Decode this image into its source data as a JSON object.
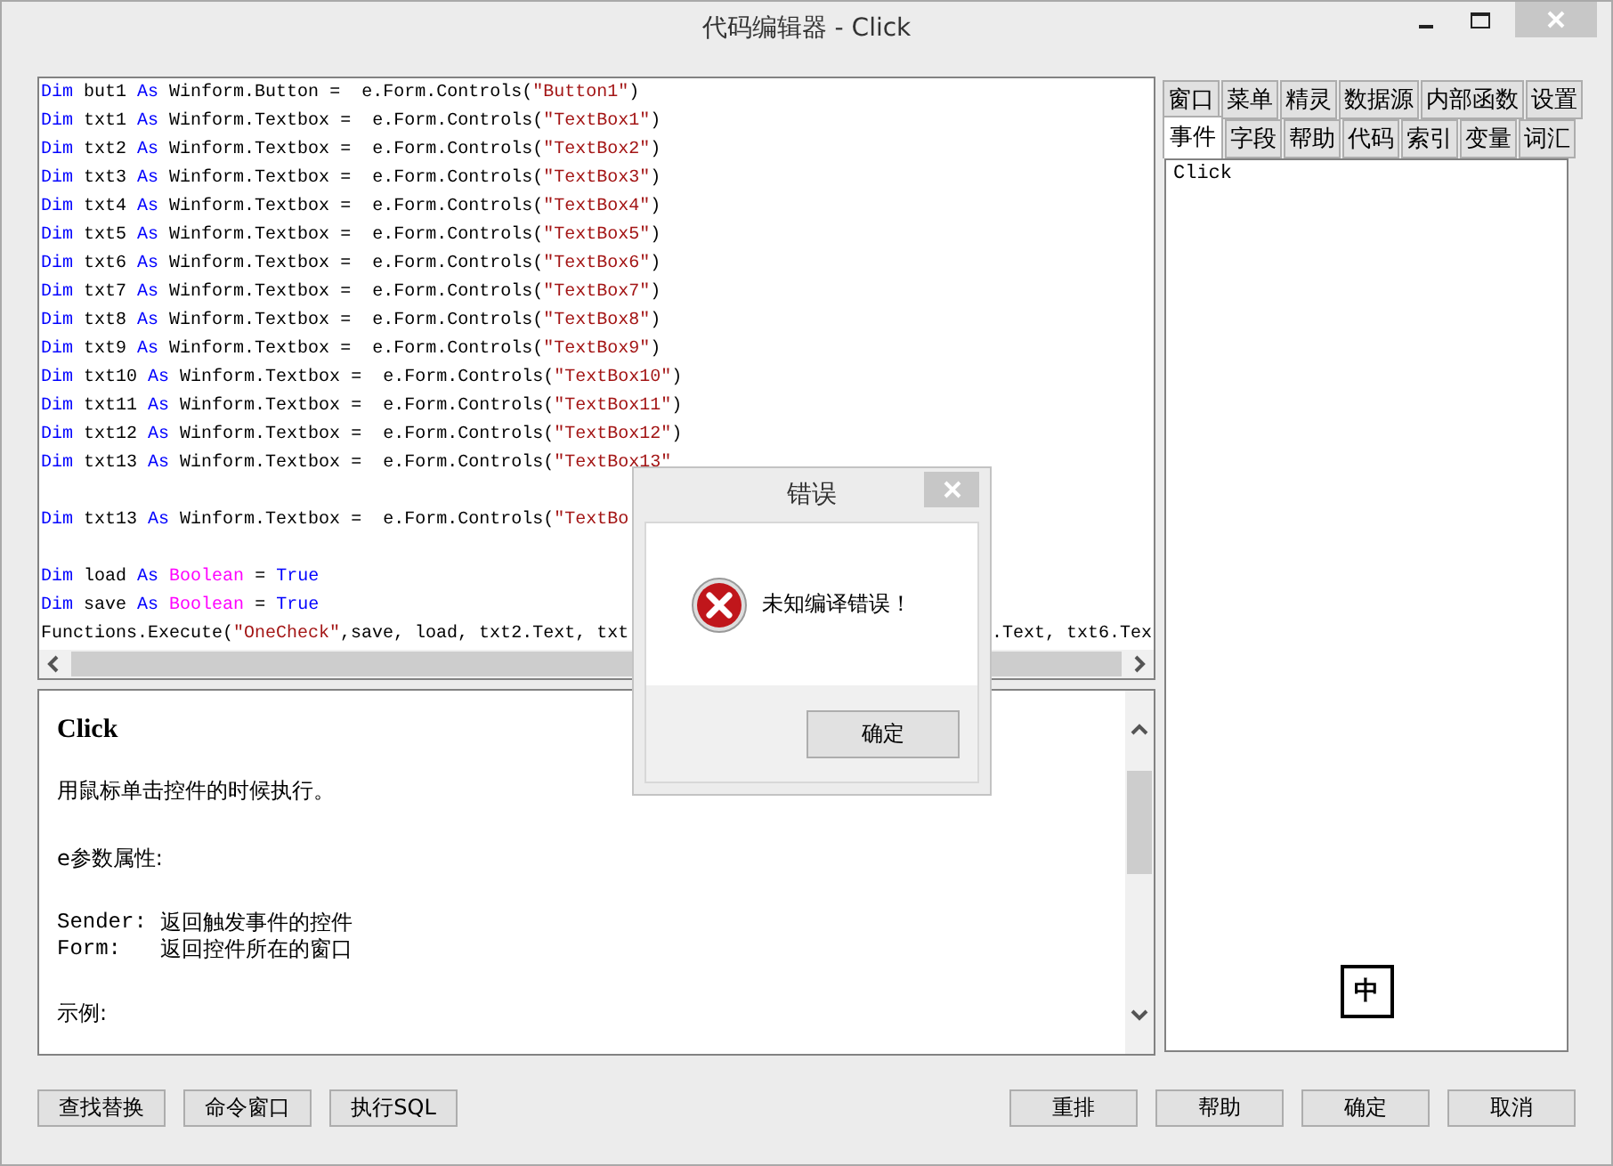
{
  "window": {
    "title": "代码编辑器 - Click"
  },
  "code_lines": [
    {
      "kind": "code",
      "segments": [
        {
          "kind": "kw",
          "text": "Dim"
        },
        {
          "kind": "plain",
          "text": " but1 "
        },
        {
          "kind": "kw",
          "text": "As"
        },
        {
          "kind": "plain",
          "text": " Winform.Button =  e.Form.Controls("
        },
        {
          "kind": "str",
          "text": "\"Button1\""
        },
        {
          "kind": "plain",
          "text": ")"
        }
      ]
    },
    {
      "kind": "code",
      "segments": [
        {
          "kind": "kw",
          "text": "Dim"
        },
        {
          "kind": "plain",
          "text": " txt1 "
        },
        {
          "kind": "kw",
          "text": "As"
        },
        {
          "kind": "plain",
          "text": " Winform.Textbox =  e.Form.Controls("
        },
        {
          "kind": "str",
          "text": "\"TextBox1\""
        },
        {
          "kind": "plain",
          "text": ")"
        }
      ]
    },
    {
      "kind": "code",
      "segments": [
        {
          "kind": "kw",
          "text": "Dim"
        },
        {
          "kind": "plain",
          "text": " txt2 "
        },
        {
          "kind": "kw",
          "text": "As"
        },
        {
          "kind": "plain",
          "text": " Winform.Textbox =  e.Form.Controls("
        },
        {
          "kind": "str",
          "text": "\"TextBox2\""
        },
        {
          "kind": "plain",
          "text": ")"
        }
      ]
    },
    {
      "kind": "code",
      "segments": [
        {
          "kind": "kw",
          "text": "Dim"
        },
        {
          "kind": "plain",
          "text": " txt3 "
        },
        {
          "kind": "kw",
          "text": "As"
        },
        {
          "kind": "plain",
          "text": " Winform.Textbox =  e.Form.Controls("
        },
        {
          "kind": "str",
          "text": "\"TextBox3\""
        },
        {
          "kind": "plain",
          "text": ")"
        }
      ]
    },
    {
      "kind": "code",
      "segments": [
        {
          "kind": "kw",
          "text": "Dim"
        },
        {
          "kind": "plain",
          "text": " txt4 "
        },
        {
          "kind": "kw",
          "text": "As"
        },
        {
          "kind": "plain",
          "text": " Winform.Textbox =  e.Form.Controls("
        },
        {
          "kind": "str",
          "text": "\"TextBox4\""
        },
        {
          "kind": "plain",
          "text": ")"
        }
      ]
    },
    {
      "kind": "code",
      "segments": [
        {
          "kind": "kw",
          "text": "Dim"
        },
        {
          "kind": "plain",
          "text": " txt5 "
        },
        {
          "kind": "kw",
          "text": "As"
        },
        {
          "kind": "plain",
          "text": " Winform.Textbox =  e.Form.Controls("
        },
        {
          "kind": "str",
          "text": "\"TextBox5\""
        },
        {
          "kind": "plain",
          "text": ")"
        }
      ]
    },
    {
      "kind": "code",
      "segments": [
        {
          "kind": "kw",
          "text": "Dim"
        },
        {
          "kind": "plain",
          "text": " txt6 "
        },
        {
          "kind": "kw",
          "text": "As"
        },
        {
          "kind": "plain",
          "text": " Winform.Textbox =  e.Form.Controls("
        },
        {
          "kind": "str",
          "text": "\"TextBox6\""
        },
        {
          "kind": "plain",
          "text": ")"
        }
      ]
    },
    {
      "kind": "code",
      "segments": [
        {
          "kind": "kw",
          "text": "Dim"
        },
        {
          "kind": "plain",
          "text": " txt7 "
        },
        {
          "kind": "kw",
          "text": "As"
        },
        {
          "kind": "plain",
          "text": " Winform.Textbox =  e.Form.Controls("
        },
        {
          "kind": "str",
          "text": "\"TextBox7\""
        },
        {
          "kind": "plain",
          "text": ")"
        }
      ]
    },
    {
      "kind": "code",
      "segments": [
        {
          "kind": "kw",
          "text": "Dim"
        },
        {
          "kind": "plain",
          "text": " txt8 "
        },
        {
          "kind": "kw",
          "text": "As"
        },
        {
          "kind": "plain",
          "text": " Winform.Textbox =  e.Form.Controls("
        },
        {
          "kind": "str",
          "text": "\"TextBox8\""
        },
        {
          "kind": "plain",
          "text": ")"
        }
      ]
    },
    {
      "kind": "code",
      "segments": [
        {
          "kind": "kw",
          "text": "Dim"
        },
        {
          "kind": "plain",
          "text": " txt9 "
        },
        {
          "kind": "kw",
          "text": "As"
        },
        {
          "kind": "plain",
          "text": " Winform.Textbox =  e.Form.Controls("
        },
        {
          "kind": "str",
          "text": "\"TextBox9\""
        },
        {
          "kind": "plain",
          "text": ")"
        }
      ]
    },
    {
      "kind": "code",
      "segments": [
        {
          "kind": "kw",
          "text": "Dim"
        },
        {
          "kind": "plain",
          "text": " txt10 "
        },
        {
          "kind": "kw",
          "text": "As"
        },
        {
          "kind": "plain",
          "text": " Winform.Textbox =  e.Form.Controls("
        },
        {
          "kind": "str",
          "text": "\"TextBox10\""
        },
        {
          "kind": "plain",
          "text": ")"
        }
      ]
    },
    {
      "kind": "code",
      "segments": [
        {
          "kind": "kw",
          "text": "Dim"
        },
        {
          "kind": "plain",
          "text": " txt11 "
        },
        {
          "kind": "kw",
          "text": "As"
        },
        {
          "kind": "plain",
          "text": " Winform.Textbox =  e.Form.Controls("
        },
        {
          "kind": "str",
          "text": "\"TextBox11\""
        },
        {
          "kind": "plain",
          "text": ")"
        }
      ]
    },
    {
      "kind": "code",
      "segments": [
        {
          "kind": "kw",
          "text": "Dim"
        },
        {
          "kind": "plain",
          "text": " txt12 "
        },
        {
          "kind": "kw",
          "text": "As"
        },
        {
          "kind": "plain",
          "text": " Winform.Textbox =  e.Form.Controls("
        },
        {
          "kind": "str",
          "text": "\"TextBox12\""
        },
        {
          "kind": "plain",
          "text": ")"
        }
      ]
    },
    {
      "kind": "code",
      "segments": [
        {
          "kind": "kw",
          "text": "Dim"
        },
        {
          "kind": "plain",
          "text": " txt13 "
        },
        {
          "kind": "kw",
          "text": "As"
        },
        {
          "kind": "plain",
          "text": " Winform.Textbox =  e.Form.Controls("
        },
        {
          "kind": "str",
          "text": "\"TextBox13\""
        }
      ]
    },
    {
      "kind": "blank"
    },
    {
      "kind": "code",
      "segments": [
        {
          "kind": "kw",
          "text": "Dim"
        },
        {
          "kind": "plain",
          "text": " txt13 "
        },
        {
          "kind": "kw",
          "text": "As"
        },
        {
          "kind": "plain",
          "text": " Winform.Textbox =  e.Form.Controls("
        },
        {
          "kind": "str",
          "text": "\"TextBo"
        }
      ]
    },
    {
      "kind": "blank"
    },
    {
      "kind": "code",
      "segments": [
        {
          "kind": "kw",
          "text": "Dim"
        },
        {
          "kind": "plain",
          "text": " load "
        },
        {
          "kind": "kw",
          "text": "As "
        },
        {
          "kind": "type",
          "text": "Boolean"
        },
        {
          "kind": "plain",
          "text": " = "
        },
        {
          "kind": "kw",
          "text": "True"
        }
      ]
    },
    {
      "kind": "code",
      "segments": [
        {
          "kind": "kw",
          "text": "Dim"
        },
        {
          "kind": "plain",
          "text": " save "
        },
        {
          "kind": "kw",
          "text": "As "
        },
        {
          "kind": "type",
          "text": "Boolean"
        },
        {
          "kind": "plain",
          "text": " = "
        },
        {
          "kind": "kw",
          "text": "True"
        }
      ]
    },
    {
      "kind": "code",
      "segments": [
        {
          "kind": "plain",
          "text": "Functions.Execute("
        },
        {
          "kind": "str",
          "text": "\"OneCheck\""
        },
        {
          "kind": "plain",
          "text": ",save, load, txt2.Text, txt"
        }
      ],
      "tail": ".Text, txt6.Tex"
    }
  ],
  "help": {
    "title": "Click",
    "intro": "用鼠标单击控件的时候执行。",
    "properties_heading": "e参数属性:",
    "properties": [
      {
        "name": "Sender:",
        "description": "返回触发事件的控件"
      },
      {
        "name": "Form:",
        "description": "返回控件所在的窗口"
      }
    ],
    "example_label": "示例:"
  },
  "tab_rows": [
    [
      {
        "label": "窗口",
        "selected": false
      },
      {
        "label": "菜单",
        "selected": false
      },
      {
        "label": "精灵",
        "selected": false
      },
      {
        "label": "数据源",
        "selected": false
      },
      {
        "label": "内部函数",
        "selected": false
      },
      {
        "label": "设置",
        "selected": false
      }
    ],
    [
      {
        "label": "事件",
        "selected": true
      },
      {
        "label": "字段",
        "selected": false
      },
      {
        "label": "帮助",
        "selected": false
      },
      {
        "label": "代码",
        "selected": false
      },
      {
        "label": "索引",
        "selected": false
      },
      {
        "label": "变量",
        "selected": false
      },
      {
        "label": "词汇",
        "selected": false
      }
    ]
  ],
  "event_list": {
    "items": [
      "Click"
    ],
    "ime_indicator": "中"
  },
  "left_buttons": [
    "查找替换",
    "命令窗口",
    "执行SQL"
  ],
  "right_buttons": [
    "重排",
    "帮助",
    "确定",
    "取消"
  ],
  "dialog": {
    "title": "错误",
    "message": "未知编译错误！",
    "button": "确定"
  }
}
